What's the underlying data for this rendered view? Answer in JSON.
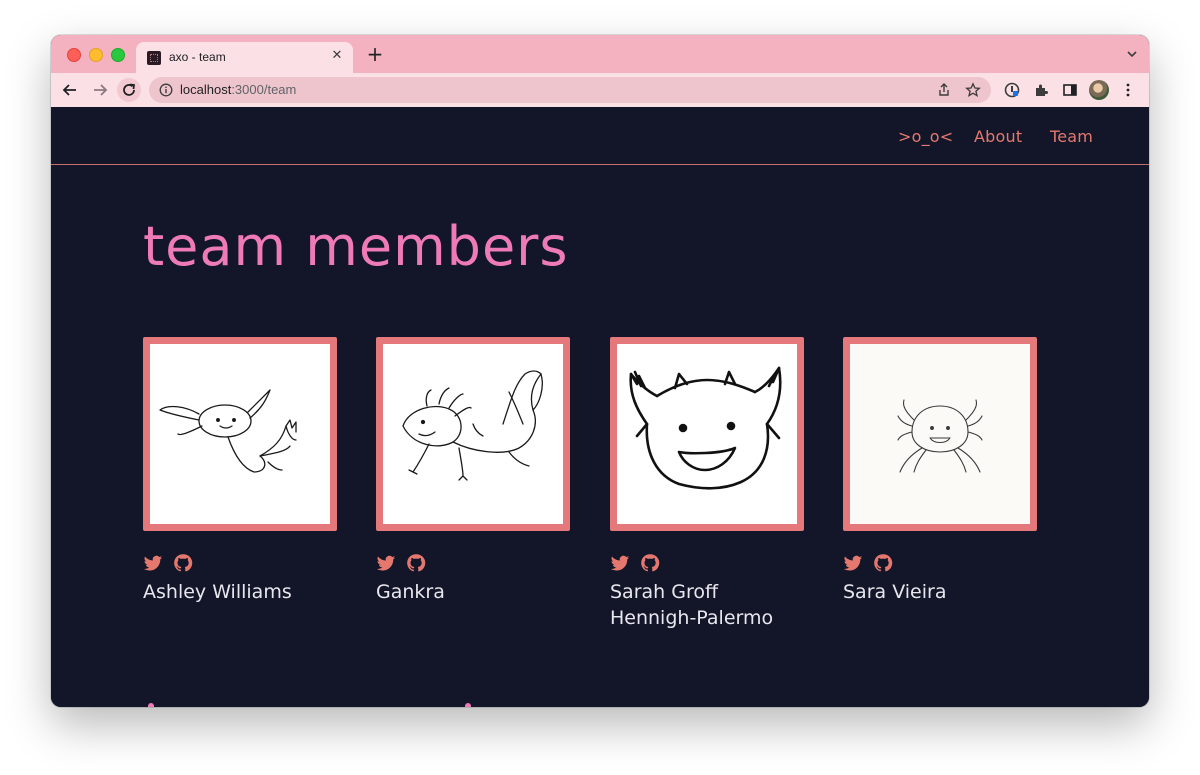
{
  "browser": {
    "tab_title": "axo - team",
    "url_host": "localhost",
    "url_path": ":3000/team"
  },
  "site": {
    "nav": {
      "logo": ">o_o<",
      "about": "About",
      "team": "Team"
    },
    "heading": "team members",
    "members": [
      {
        "name": "Ashley Williams",
        "avatar": "axolotl-floating-drawing"
      },
      {
        "name": "Gankra",
        "avatar": "axolotl-swimming-drawing"
      },
      {
        "name": "Sarah Groff Hennigh-Palermo",
        "avatar": "horned-face-drawing"
      },
      {
        "name": "Sara Vieira",
        "avatar": "small-axolotl-drawing"
      }
    ]
  },
  "colors": {
    "page_bg": "#131628",
    "accent": "#e4786f",
    "heading": "#ef7ab8",
    "frame": "#e4787a",
    "tab_strip": "#f4b1bf"
  },
  "icons": [
    "twitter-icon",
    "github-icon"
  ]
}
